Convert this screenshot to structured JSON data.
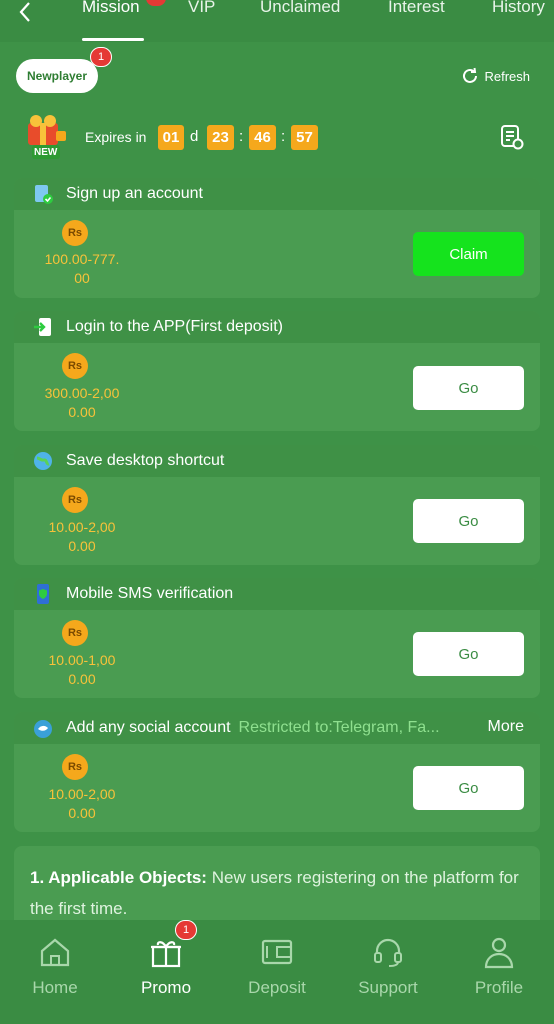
{
  "tabs": [
    {
      "label": "Mission",
      "active": true
    },
    {
      "label": "VIP"
    },
    {
      "label": "Unclaimed"
    },
    {
      "label": "Interest"
    },
    {
      "label": "History"
    }
  ],
  "newplayer": {
    "label": "Newplayer",
    "badge": "1"
  },
  "refresh_label": "Refresh",
  "gift_badge": "NEW",
  "countdown": {
    "label": "Expires in",
    "days": "01",
    "day_unit": "d",
    "hours": "23",
    "minutes": "46",
    "seconds": "57",
    "sep": ":"
  },
  "currency_symbol": "Rs",
  "missions": [
    {
      "title": "Sign up an account",
      "reward_line1": "100.00-777.",
      "reward_line2": "00",
      "button": "Claim",
      "icon": "clipboard-check-icon"
    },
    {
      "title": "Login to the APP(First deposit)",
      "reward_line1": "300.00-2,00",
      "reward_line2": "0.00",
      "button": "Go",
      "icon": "login-icon"
    },
    {
      "title": "Save desktop shortcut",
      "reward_line1": "10.00-2,00",
      "reward_line2": "0.00",
      "button": "Go",
      "icon": "globe-icon"
    },
    {
      "title": "Mobile SMS verification",
      "reward_line1": "10.00-1,00",
      "reward_line2": "0.00",
      "button": "Go",
      "icon": "phone-shield-icon"
    },
    {
      "title": "Add any social account",
      "restricted": "Restricted to:Telegram, Fa...",
      "more": "More",
      "reward_line1": "10.00-2,00",
      "reward_line2": "0.00",
      "button": "Go",
      "icon": "social-bird-icon"
    }
  ],
  "rules": {
    "heading": "1. Applicable Objects:",
    "text": " New users registering on the platform for the first time."
  },
  "bottom_nav": [
    {
      "label": "Home",
      "icon": "home-icon"
    },
    {
      "label": "Promo",
      "icon": "gift-icon",
      "active": true,
      "badge": "1"
    },
    {
      "label": "Deposit",
      "icon": "wallet-icon"
    },
    {
      "label": "Support",
      "icon": "headset-icon"
    },
    {
      "label": "Profile",
      "icon": "user-icon"
    }
  ],
  "colors": {
    "accent": "#15e31d",
    "coin": "#f5a81c",
    "badge": "#e53935",
    "background": "#3e9247"
  }
}
